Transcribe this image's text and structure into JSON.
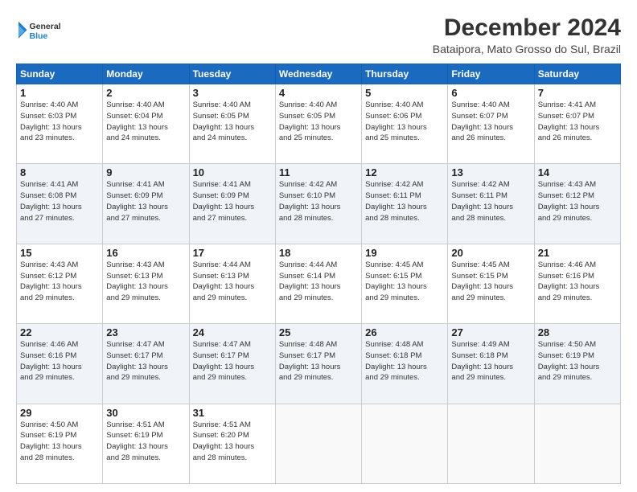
{
  "logo": {
    "line1": "General",
    "line2": "Blue"
  },
  "title": "December 2024",
  "subtitle": "Bataipora, Mato Grosso do Sul, Brazil",
  "weekdays": [
    "Sunday",
    "Monday",
    "Tuesday",
    "Wednesday",
    "Thursday",
    "Friday",
    "Saturday"
  ],
  "weeks": [
    [
      {
        "day": 1,
        "info": "Sunrise: 4:40 AM\nSunset: 6:03 PM\nDaylight: 13 hours\nand 23 minutes."
      },
      {
        "day": 2,
        "info": "Sunrise: 4:40 AM\nSunset: 6:04 PM\nDaylight: 13 hours\nand 24 minutes."
      },
      {
        "day": 3,
        "info": "Sunrise: 4:40 AM\nSunset: 6:05 PM\nDaylight: 13 hours\nand 24 minutes."
      },
      {
        "day": 4,
        "info": "Sunrise: 4:40 AM\nSunset: 6:05 PM\nDaylight: 13 hours\nand 25 minutes."
      },
      {
        "day": 5,
        "info": "Sunrise: 4:40 AM\nSunset: 6:06 PM\nDaylight: 13 hours\nand 25 minutes."
      },
      {
        "day": 6,
        "info": "Sunrise: 4:40 AM\nSunset: 6:07 PM\nDaylight: 13 hours\nand 26 minutes."
      },
      {
        "day": 7,
        "info": "Sunrise: 4:41 AM\nSunset: 6:07 PM\nDaylight: 13 hours\nand 26 minutes."
      }
    ],
    [
      {
        "day": 8,
        "info": "Sunrise: 4:41 AM\nSunset: 6:08 PM\nDaylight: 13 hours\nand 27 minutes."
      },
      {
        "day": 9,
        "info": "Sunrise: 4:41 AM\nSunset: 6:09 PM\nDaylight: 13 hours\nand 27 minutes."
      },
      {
        "day": 10,
        "info": "Sunrise: 4:41 AM\nSunset: 6:09 PM\nDaylight: 13 hours\nand 27 minutes."
      },
      {
        "day": 11,
        "info": "Sunrise: 4:42 AM\nSunset: 6:10 PM\nDaylight: 13 hours\nand 28 minutes."
      },
      {
        "day": 12,
        "info": "Sunrise: 4:42 AM\nSunset: 6:11 PM\nDaylight: 13 hours\nand 28 minutes."
      },
      {
        "day": 13,
        "info": "Sunrise: 4:42 AM\nSunset: 6:11 PM\nDaylight: 13 hours\nand 28 minutes."
      },
      {
        "day": 14,
        "info": "Sunrise: 4:43 AM\nSunset: 6:12 PM\nDaylight: 13 hours\nand 29 minutes."
      }
    ],
    [
      {
        "day": 15,
        "info": "Sunrise: 4:43 AM\nSunset: 6:12 PM\nDaylight: 13 hours\nand 29 minutes."
      },
      {
        "day": 16,
        "info": "Sunrise: 4:43 AM\nSunset: 6:13 PM\nDaylight: 13 hours\nand 29 minutes."
      },
      {
        "day": 17,
        "info": "Sunrise: 4:44 AM\nSunset: 6:13 PM\nDaylight: 13 hours\nand 29 minutes."
      },
      {
        "day": 18,
        "info": "Sunrise: 4:44 AM\nSunset: 6:14 PM\nDaylight: 13 hours\nand 29 minutes."
      },
      {
        "day": 19,
        "info": "Sunrise: 4:45 AM\nSunset: 6:15 PM\nDaylight: 13 hours\nand 29 minutes."
      },
      {
        "day": 20,
        "info": "Sunrise: 4:45 AM\nSunset: 6:15 PM\nDaylight: 13 hours\nand 29 minutes."
      },
      {
        "day": 21,
        "info": "Sunrise: 4:46 AM\nSunset: 6:16 PM\nDaylight: 13 hours\nand 29 minutes."
      }
    ],
    [
      {
        "day": 22,
        "info": "Sunrise: 4:46 AM\nSunset: 6:16 PM\nDaylight: 13 hours\nand 29 minutes."
      },
      {
        "day": 23,
        "info": "Sunrise: 4:47 AM\nSunset: 6:17 PM\nDaylight: 13 hours\nand 29 minutes."
      },
      {
        "day": 24,
        "info": "Sunrise: 4:47 AM\nSunset: 6:17 PM\nDaylight: 13 hours\nand 29 minutes."
      },
      {
        "day": 25,
        "info": "Sunrise: 4:48 AM\nSunset: 6:17 PM\nDaylight: 13 hours\nand 29 minutes."
      },
      {
        "day": 26,
        "info": "Sunrise: 4:48 AM\nSunset: 6:18 PM\nDaylight: 13 hours\nand 29 minutes."
      },
      {
        "day": 27,
        "info": "Sunrise: 4:49 AM\nSunset: 6:18 PM\nDaylight: 13 hours\nand 29 minutes."
      },
      {
        "day": 28,
        "info": "Sunrise: 4:50 AM\nSunset: 6:19 PM\nDaylight: 13 hours\nand 29 minutes."
      }
    ],
    [
      {
        "day": 29,
        "info": "Sunrise: 4:50 AM\nSunset: 6:19 PM\nDaylight: 13 hours\nand 28 minutes."
      },
      {
        "day": 30,
        "info": "Sunrise: 4:51 AM\nSunset: 6:19 PM\nDaylight: 13 hours\nand 28 minutes."
      },
      {
        "day": 31,
        "info": "Sunrise: 4:51 AM\nSunset: 6:20 PM\nDaylight: 13 hours\nand 28 minutes."
      },
      null,
      null,
      null,
      null
    ]
  ]
}
